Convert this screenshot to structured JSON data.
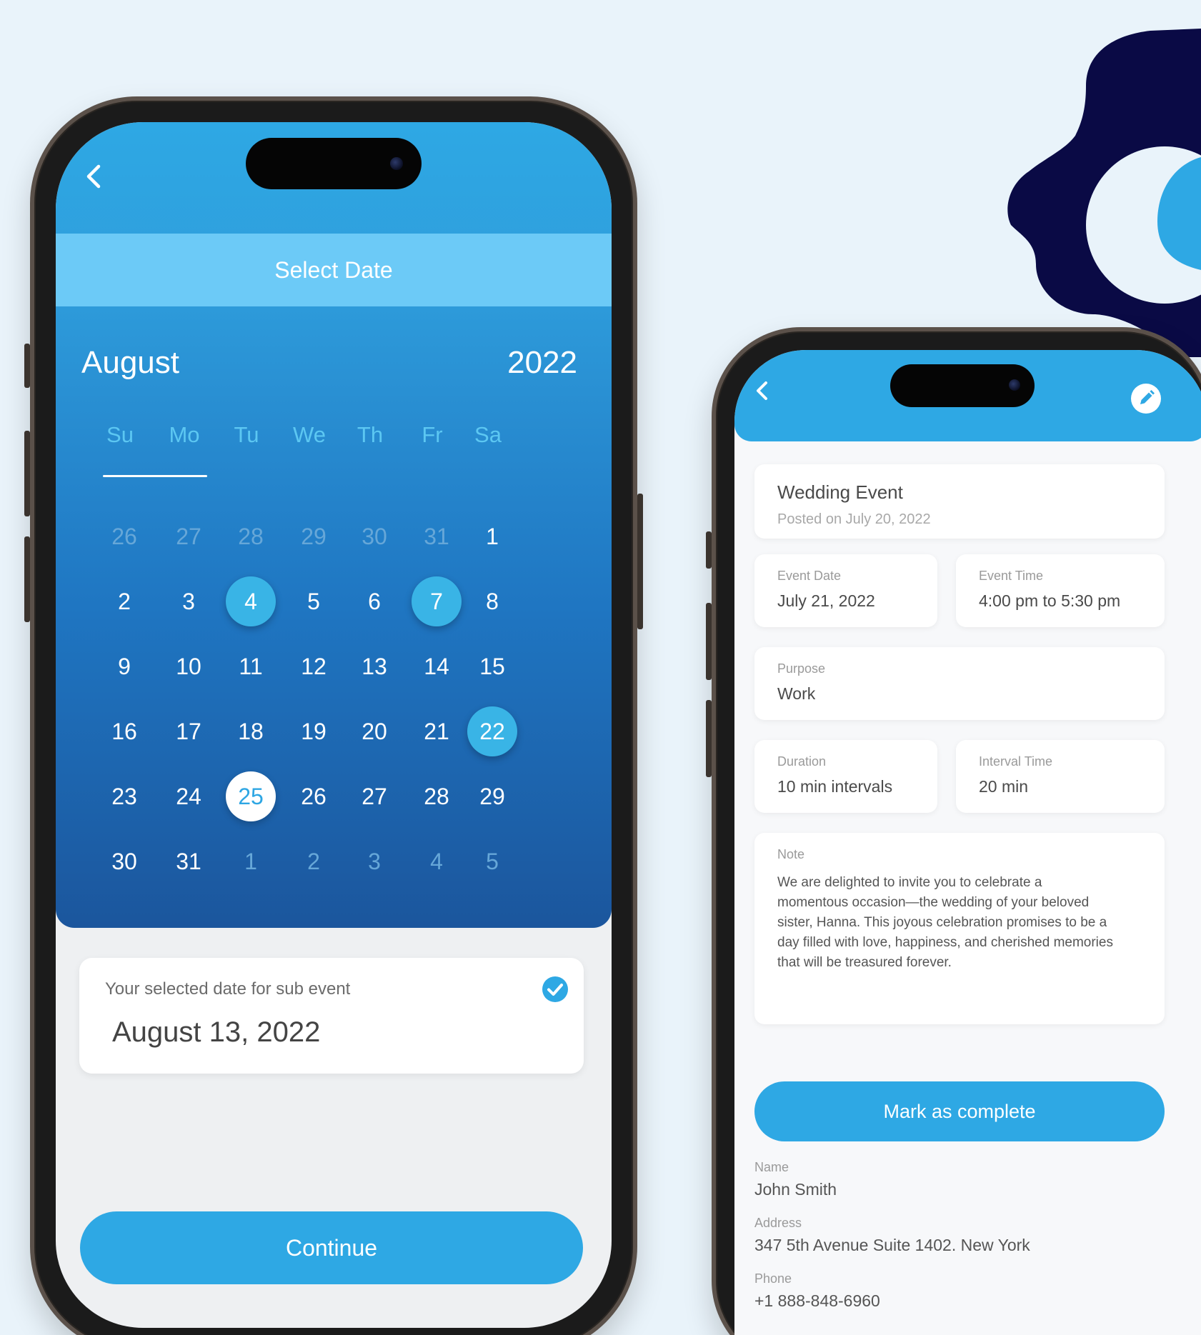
{
  "colors": {
    "accent": "#2ea8e4",
    "select_bar": "#6ccaf7",
    "logo_dark": "#0a0a45",
    "background": "#e9f3fa"
  },
  "calendar_screen": {
    "header_title": "Select Date",
    "month": "August",
    "year": "2022",
    "weekdays": [
      "Su",
      "Mo",
      "Tu",
      "We",
      "Th",
      "Fr",
      "Sa"
    ],
    "weeks": [
      [
        {
          "d": "26",
          "m": true
        },
        {
          "d": "27",
          "m": true
        },
        {
          "d": "28",
          "m": true
        },
        {
          "d": "29",
          "m": true
        },
        {
          "d": "30",
          "m": true
        },
        {
          "d": "31",
          "m": true
        },
        {
          "d": "1"
        }
      ],
      [
        {
          "d": "2"
        },
        {
          "d": "3"
        },
        {
          "d": "4",
          "s": "hl"
        },
        {
          "d": "5"
        },
        {
          "d": "6"
        },
        {
          "d": "7",
          "s": "hl"
        },
        {
          "d": "8"
        }
      ],
      [
        {
          "d": "9"
        },
        {
          "d": "10"
        },
        {
          "d": "11"
        },
        {
          "d": "12"
        },
        {
          "d": "13"
        },
        {
          "d": "14"
        },
        {
          "d": "15"
        }
      ],
      [
        {
          "d": "16"
        },
        {
          "d": "17"
        },
        {
          "d": "18"
        },
        {
          "d": "19"
        },
        {
          "d": "20"
        },
        {
          "d": "21"
        },
        {
          "d": "22",
          "s": "hl"
        }
      ],
      [
        {
          "d": "23"
        },
        {
          "d": "24"
        },
        {
          "d": "25",
          "s": "sel"
        },
        {
          "d": "26"
        },
        {
          "d": "27"
        },
        {
          "d": "28"
        },
        {
          "d": "29"
        }
      ],
      [
        {
          "d": "30"
        },
        {
          "d": "31"
        },
        {
          "d": "1",
          "m": true
        },
        {
          "d": "2",
          "m": true
        },
        {
          "d": "3",
          "m": true
        },
        {
          "d": "4",
          "m": true
        },
        {
          "d": "5",
          "m": true
        }
      ]
    ],
    "selected_card": {
      "label": "Your selected date for sub event",
      "value": "August 13, 2022",
      "icon": "check-circle-icon"
    },
    "continue_label": "Continue",
    "icons": {
      "back": "chevron-left-icon"
    }
  },
  "detail_screen": {
    "icons": {
      "back": "chevron-left-icon",
      "edit": "pencil-icon"
    },
    "event_title": "Wedding Event",
    "posted_on": "Posted on July 20, 2022",
    "event_date_label": "Event Date",
    "event_date": "July 21, 2022",
    "event_time_label": "Event Time",
    "event_time": "4:00 pm to 5:30 pm",
    "purpose_label": "Purpose",
    "purpose": "Work",
    "duration_label": "Duration",
    "duration": "10 min intervals",
    "interval_label": "Interval Time",
    "interval": "20 min",
    "note_label": "Note",
    "note_lines": [
      "We are delighted to invite you to celebrate a",
      "momentous occasion—the wedding of your beloved",
      "sister, Hanna. This joyous celebration promises to be a",
      "day filled with love, happiness, and cherished memories",
      "that will be treasured forever."
    ],
    "mark_complete_label": "Mark as complete",
    "name_label": "Name",
    "name": "John Smith",
    "address_label": "Address",
    "address": "347 5th Avenue Suite 1402. New York",
    "phone_label": "Phone",
    "phone": "+1 888-848-6960"
  }
}
